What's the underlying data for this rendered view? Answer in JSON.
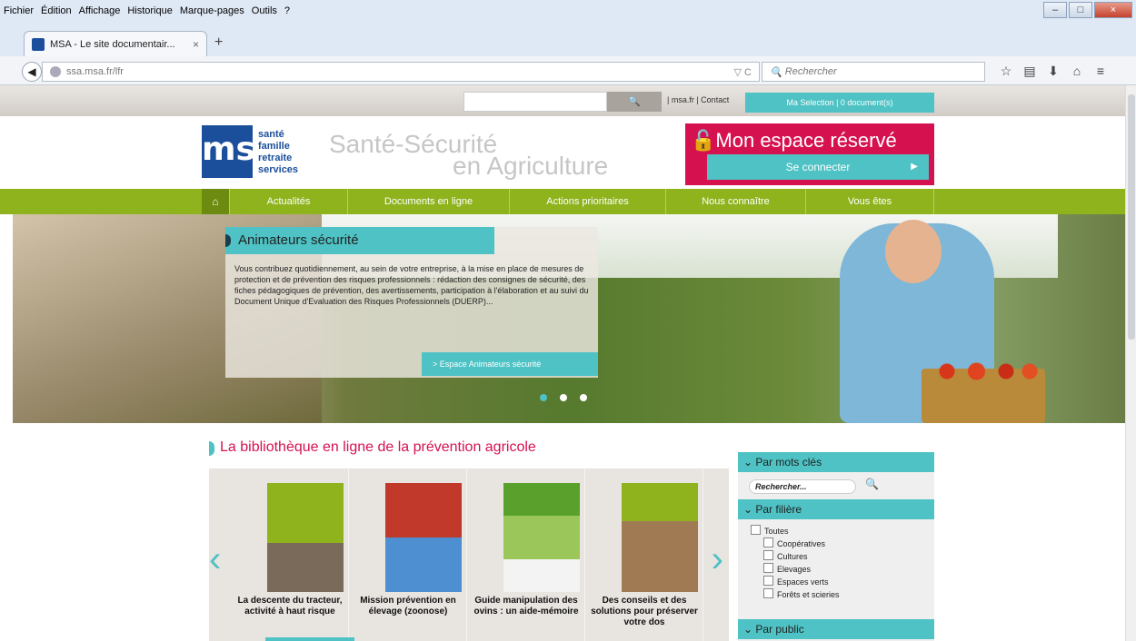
{
  "menu": [
    "Fichier",
    "Édition",
    "Affichage",
    "Historique",
    "Marque-pages",
    "Outils",
    "?"
  ],
  "tab": {
    "title": "MSA - Le site documentair...",
    "close": "×",
    "new": "+"
  },
  "url": "ssa.msa.fr/lfr",
  "browser_search_placeholder": "Rechercher",
  "top": {
    "links": "| msa.fr  |  Contact",
    "selection": "Ma Selection | 0 document(s)"
  },
  "logo": {
    "mark": "msa",
    "words": [
      "santé",
      "famille",
      "retraite",
      "services"
    ]
  },
  "tagline": {
    "line1": "Santé-Sécurité",
    "line2": "en Agriculture"
  },
  "espace": {
    "title": "Mon espace réservé",
    "connect": "Se connecter"
  },
  "nav": [
    "Actualités",
    "Documents en ligne",
    "Actions prioritaires",
    "Nous connaître",
    "Vous êtes"
  ],
  "hero": {
    "title": "Animateurs sécurité",
    "text": "Vous contribuez quotidiennement, au sein de votre entreprise, à la mise en place de mesures de protection et de prévention des risques professionnels : rédaction des consignes de sécurité, des fiches pédagogiques de prévention, des avertissements, participation à l'élaboration et au suivi du Document Unique d'Evaluation des Risques Professionnels (DUERP)...",
    "button": "> Espace Animateurs sécurité"
  },
  "library": {
    "title": "La bibliothèque en ligne de la prévention agricole",
    "books": [
      {
        "caption": "La descente du tracteur, activité à haut risque",
        "color": "#8fb31d"
      },
      {
        "caption": "Mission prévention en élevage (zoonose)",
        "color": "#c0392b"
      },
      {
        "caption": "Guide manipulation des ovins : un aide-mémoire",
        "color": "#5aa02c"
      },
      {
        "caption": "Des conseils et des solutions pour préserver votre dos",
        "color": "#8fb31d"
      }
    ]
  },
  "sidebar": {
    "keywords": "Par mots clés",
    "search_placeholder": "Rechercher...",
    "filiere": "Par filière",
    "filiere_items": [
      "Toutes",
      "Coopératives",
      "Cultures",
      "Elevages",
      "Espaces verts",
      "Forêts et scieries"
    ],
    "public": "Par public"
  },
  "colors": {
    "teal": "#4ec2c4",
    "green": "#8fb31d",
    "crimson": "#d6114f",
    "blue": "#1b4f9c"
  }
}
